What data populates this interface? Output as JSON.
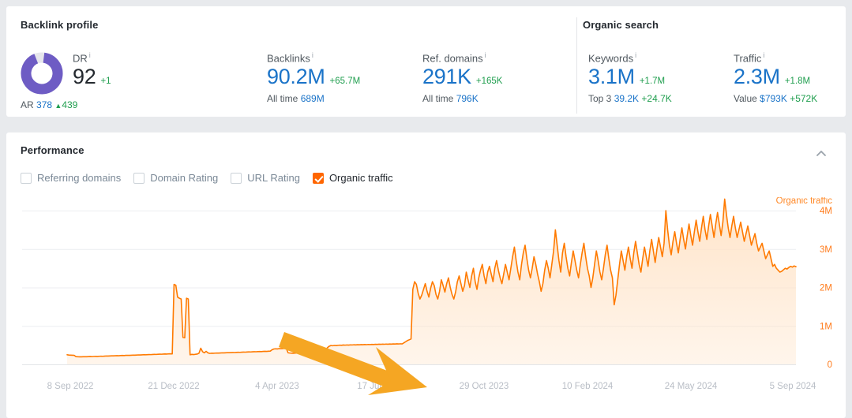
{
  "backlink_profile": {
    "title": "Backlink profile",
    "dr": {
      "label": "DR",
      "info": "i",
      "value": "92",
      "delta": "+1",
      "ring_percent": 92,
      "ring_color": "#6e5cc4",
      "ring_track_color": "#e6e6ec"
    },
    "ar": {
      "label": "AR",
      "value": "378",
      "delta": "439",
      "delta_arrow": "▲"
    },
    "backlinks": {
      "label": "Backlinks",
      "info": "i",
      "value": "90.2M",
      "delta": "+65.7M",
      "sub_label": "All time",
      "sub_value": "689M"
    },
    "ref_domains": {
      "label": "Ref. domains",
      "info": "i",
      "value": "291K",
      "delta": "+165K",
      "sub_label": "All time",
      "sub_value": "796K"
    }
  },
  "organic_search": {
    "title": "Organic search",
    "keywords": {
      "label": "Keywords",
      "info": "i",
      "value": "3.1M",
      "delta": "+1.7M",
      "sub_label": "Top 3",
      "sub_value": "39.2K",
      "sub_delta": "+24.7K"
    },
    "traffic": {
      "label": "Traffic",
      "info": "i",
      "value": "2.3M",
      "delta": "+1.8M",
      "sub_label": "Value",
      "sub_value": "$793K",
      "sub_delta": "+572K"
    }
  },
  "performance": {
    "title": "Performance",
    "collapse_icon": "chevron-up-icon",
    "legend": [
      {
        "label": "Referring domains",
        "checked": false
      },
      {
        "label": "Domain Rating",
        "checked": false
      },
      {
        "label": "URL Rating",
        "checked": false
      },
      {
        "label": "Organic traffic",
        "checked": true
      }
    ],
    "accent_color": "#ff6600",
    "annotation": {
      "type": "arrow",
      "color": "#f5a623",
      "points_at": "organic traffic inflection point"
    }
  },
  "chart_data": {
    "type": "area",
    "title": "Performance",
    "series_name": "Organic traffic",
    "line_color": "#ff7a00",
    "fill_color": "#ffe3c7",
    "xlabel": "",
    "ylabel": "Organic traffic",
    "ylim": [
      0,
      4500000
    ],
    "yticks": [
      0,
      1000000,
      2000000,
      3000000,
      4000000
    ],
    "ytick_labels": [
      "0",
      "1M",
      "2M",
      "3M",
      "4M"
    ],
    "grid": true,
    "legend_position": "top-right",
    "xticks": [
      "8 Sep 2022",
      "21 Dec 2022",
      "4 Apr 2023",
      "17 Jul 2023",
      "29 Oct 2023",
      "10 Feb 2024",
      "24 May 2024",
      "5 Sep 2024"
    ],
    "x_start": "8 Sep 2022",
    "x_end": "5 Sep 2024",
    "values": [
      250000,
      243000,
      240000,
      237000,
      234000,
      200000,
      198000,
      197000,
      196000,
      198000,
      200000,
      199000,
      201000,
      203000,
      200000,
      205000,
      207000,
      204000,
      210000,
      213000,
      210000,
      215000,
      218000,
      216000,
      220000,
      222000,
      221000,
      224000,
      227000,
      225000,
      229000,
      232000,
      230000,
      234000,
      236000,
      234000,
      238000,
      241000,
      239000,
      243000,
      246000,
      244000,
      248000,
      251000,
      249000,
      253000,
      256000,
      254000,
      258000,
      261000,
      259000,
      263000,
      266000,
      264000,
      268000,
      271000,
      269000,
      273000,
      276000,
      274000,
      2080000,
      2060000,
      1750000,
      1720000,
      1700000,
      700000,
      690000,
      1720000,
      1700000,
      250000,
      260000,
      255000,
      262000,
      268000,
      290000,
      420000,
      330000,
      300000,
      340000,
      300000,
      285000,
      290000,
      288000,
      292000,
      295000,
      293000,
      297000,
      300000,
      298000,
      302000,
      305000,
      303000,
      307000,
      310000,
      308000,
      312000,
      315000,
      313000,
      317000,
      320000,
      318000,
      322000,
      325000,
      323000,
      327000,
      330000,
      328000,
      332000,
      335000,
      333000,
      337000,
      340000,
      338000,
      342000,
      345000,
      380000,
      400000,
      405000,
      402000,
      410000,
      408000,
      412000,
      415000,
      413000,
      300000,
      295000,
      290000,
      288000,
      292000,
      295000,
      293000,
      297000,
      300000,
      298000,
      302000,
      305000,
      303000,
      307000,
      310000,
      308000,
      312000,
      315000,
      313000,
      317000,
      320000,
      360000,
      430000,
      470000,
      490000,
      485000,
      492000,
      488000,
      495000,
      500000,
      497000,
      503000,
      500000,
      505000,
      502000,
      508000,
      505000,
      510000,
      507000,
      512000,
      509000,
      514000,
      511000,
      516000,
      513000,
      518000,
      515000,
      520000,
      517000,
      522000,
      519000,
      524000,
      521000,
      526000,
      523000,
      528000,
      525000,
      530000,
      527000,
      532000,
      529000,
      534000,
      531000,
      536000,
      533000,
      560000,
      590000,
      620000,
      640000,
      660000,
      1950000,
      2150000,
      2080000,
      1850000,
      1700000,
      1800000,
      1950000,
      2100000,
      1900000,
      1750000,
      1980000,
      2150000,
      2050000,
      1820000,
      1700000,
      1900000,
      2200000,
      2050000,
      1880000,
      2100000,
      2250000,
      2000000,
      1820000,
      1700000,
      1880000,
      2150000,
      2300000,
      2100000,
      1900000,
      2050000,
      2400000,
      2200000,
      2000000,
      2300000,
      2500000,
      2150000,
      1950000,
      2250000,
      2450000,
      2600000,
      2300000,
      2100000,
      2400000,
      2550000,
      2350000,
      2150000,
      2500000,
      2700000,
      2450000,
      2250000,
      2100000,
      2350000,
      2600000,
      2400000,
      2200000,
      2500000,
      2800000,
      3050000,
      2700000,
      2400000,
      2200000,
      2600000,
      2900000,
      3100000,
      2750000,
      2450000,
      2250000,
      2500000,
      2800000,
      2600000,
      2350000,
      2150000,
      1900000,
      2100000,
      2450000,
      2700000,
      2500000,
      2250000,
      2600000,
      2950000,
      3500000,
      3100000,
      2700000,
      2400000,
      2900000,
      3150000,
      2800000,
      2500000,
      2300000,
      2650000,
      2950000,
      2700000,
      2450000,
      2250000,
      2600000,
      2900000,
      3150000,
      2800000,
      2500000,
      2300000,
      2000000,
      2250000,
      2600000,
      2950000,
      2700000,
      2400000,
      2200000,
      2500000,
      2850000,
      3100000,
      2750000,
      2450000,
      2250000,
      1550000,
      1800000,
      2200000,
      2600000,
      2950000,
      2700000,
      2450000,
      2800000,
      3050000,
      2750000,
      2500000,
      2900000,
      3200000,
      2900000,
      2600000,
      2400000,
      2750000,
      3050000,
      2800000,
      2550000,
      2950000,
      3250000,
      2950000,
      2650000,
      3000000,
      3300000,
      3050000,
      2800000,
      3150000,
      4000000,
      3500000,
      3100000,
      2850000,
      3200000,
      3450000,
      3150000,
      2900000,
      3250000,
      3550000,
      3250000,
      3000000,
      3350000,
      3650000,
      3350000,
      3100000,
      3450000,
      3750000,
      3450000,
      3200000,
      3550000,
      3850000,
      3500000,
      3250000,
      3600000,
      3900000,
      3600000,
      3300000,
      3650000,
      3950000,
      3650000,
      3350000,
      3700000,
      4300000,
      3900000,
      3550000,
      3300000,
      3600000,
      3850000,
      3550000,
      3300000,
      3500000,
      3700000,
      3450000,
      3200000,
      3400000,
      3600000,
      3350000,
      3100000,
      3250000,
      3400000,
      3150000,
      2950000,
      3050000,
      3150000,
      2950000,
      2750000,
      2850000,
      2950000,
      2750000,
      2550000,
      2600000,
      2500000,
      2450000,
      2400000,
      2420000,
      2460000,
      2500000,
      2480000,
      2520000,
      2550000,
      2530000,
      2560000,
      2540000
    ]
  }
}
